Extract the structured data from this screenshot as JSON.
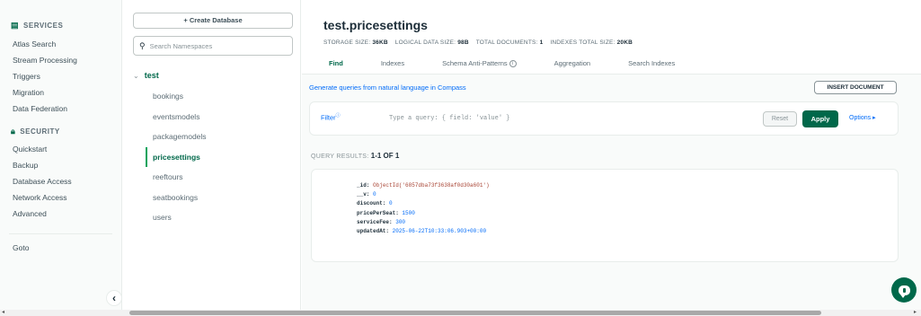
{
  "leftnav": {
    "services_header": "SERVICES",
    "services_items": [
      "Atlas Search",
      "Stream Processing",
      "Triggers",
      "Migration",
      "Data Federation"
    ],
    "security_header": "SECURITY",
    "security_items": [
      "Quickstart",
      "Backup",
      "Database Access",
      "Network Access",
      "Advanced"
    ],
    "goto": "Goto",
    "collapse_glyph": "‹"
  },
  "dbpanel": {
    "create_label": "+ Create Database",
    "search_placeholder": "Search Namespaces",
    "database": "test",
    "collections": [
      "bookings",
      "eventsmodels",
      "packagemodels",
      "pricesettings",
      "reeftours",
      "seatbookings",
      "users"
    ],
    "active_collection": "pricesettings"
  },
  "main": {
    "title": "test.pricesettings",
    "stats": {
      "storage_label": "STORAGE SIZE:",
      "storage_value": "36KB",
      "logical_label": "LOGICAL DATA SIZE:",
      "logical_value": "98B",
      "docs_label": "TOTAL DOCUMENTS:",
      "docs_value": "1",
      "index_label": "INDEXES TOTAL SIZE:",
      "index_value": "20KB"
    },
    "tabs": [
      "Find",
      "Indexes",
      "Schema Anti-Patterns",
      "Aggregation",
      "Search Indexes"
    ],
    "nlq_link": "Generate queries from natural language in Compass",
    "insert_button": "INSERT DOCUMENT",
    "filter_label": "Filter",
    "filter_placeholder": "Type a query: { field: 'value' }",
    "reset_button": "Reset",
    "apply_button": "Apply",
    "options_button": "Options ▸",
    "query_results_label": "QUERY RESULTS:",
    "query_results_value": "1-1 OF 1",
    "document": {
      "id_key": "_id:",
      "id_value": "ObjectId('6857dba73f3638af0d30a601')",
      "v_key": "__v:",
      "v_value": "0",
      "discount_key": "discount:",
      "discount_value": "0",
      "price_key": "pricePerSeat:",
      "price_value": "1500",
      "fee_key": "serviceFee:",
      "fee_value": "300",
      "updated_key": "updatedAt:",
      "updated_value": "2025-06-22T10:33:06.903+00:00"
    }
  },
  "colors": {
    "accent_green": "#00684a",
    "link_blue": "#016bf8",
    "string_red": "#a84434"
  }
}
